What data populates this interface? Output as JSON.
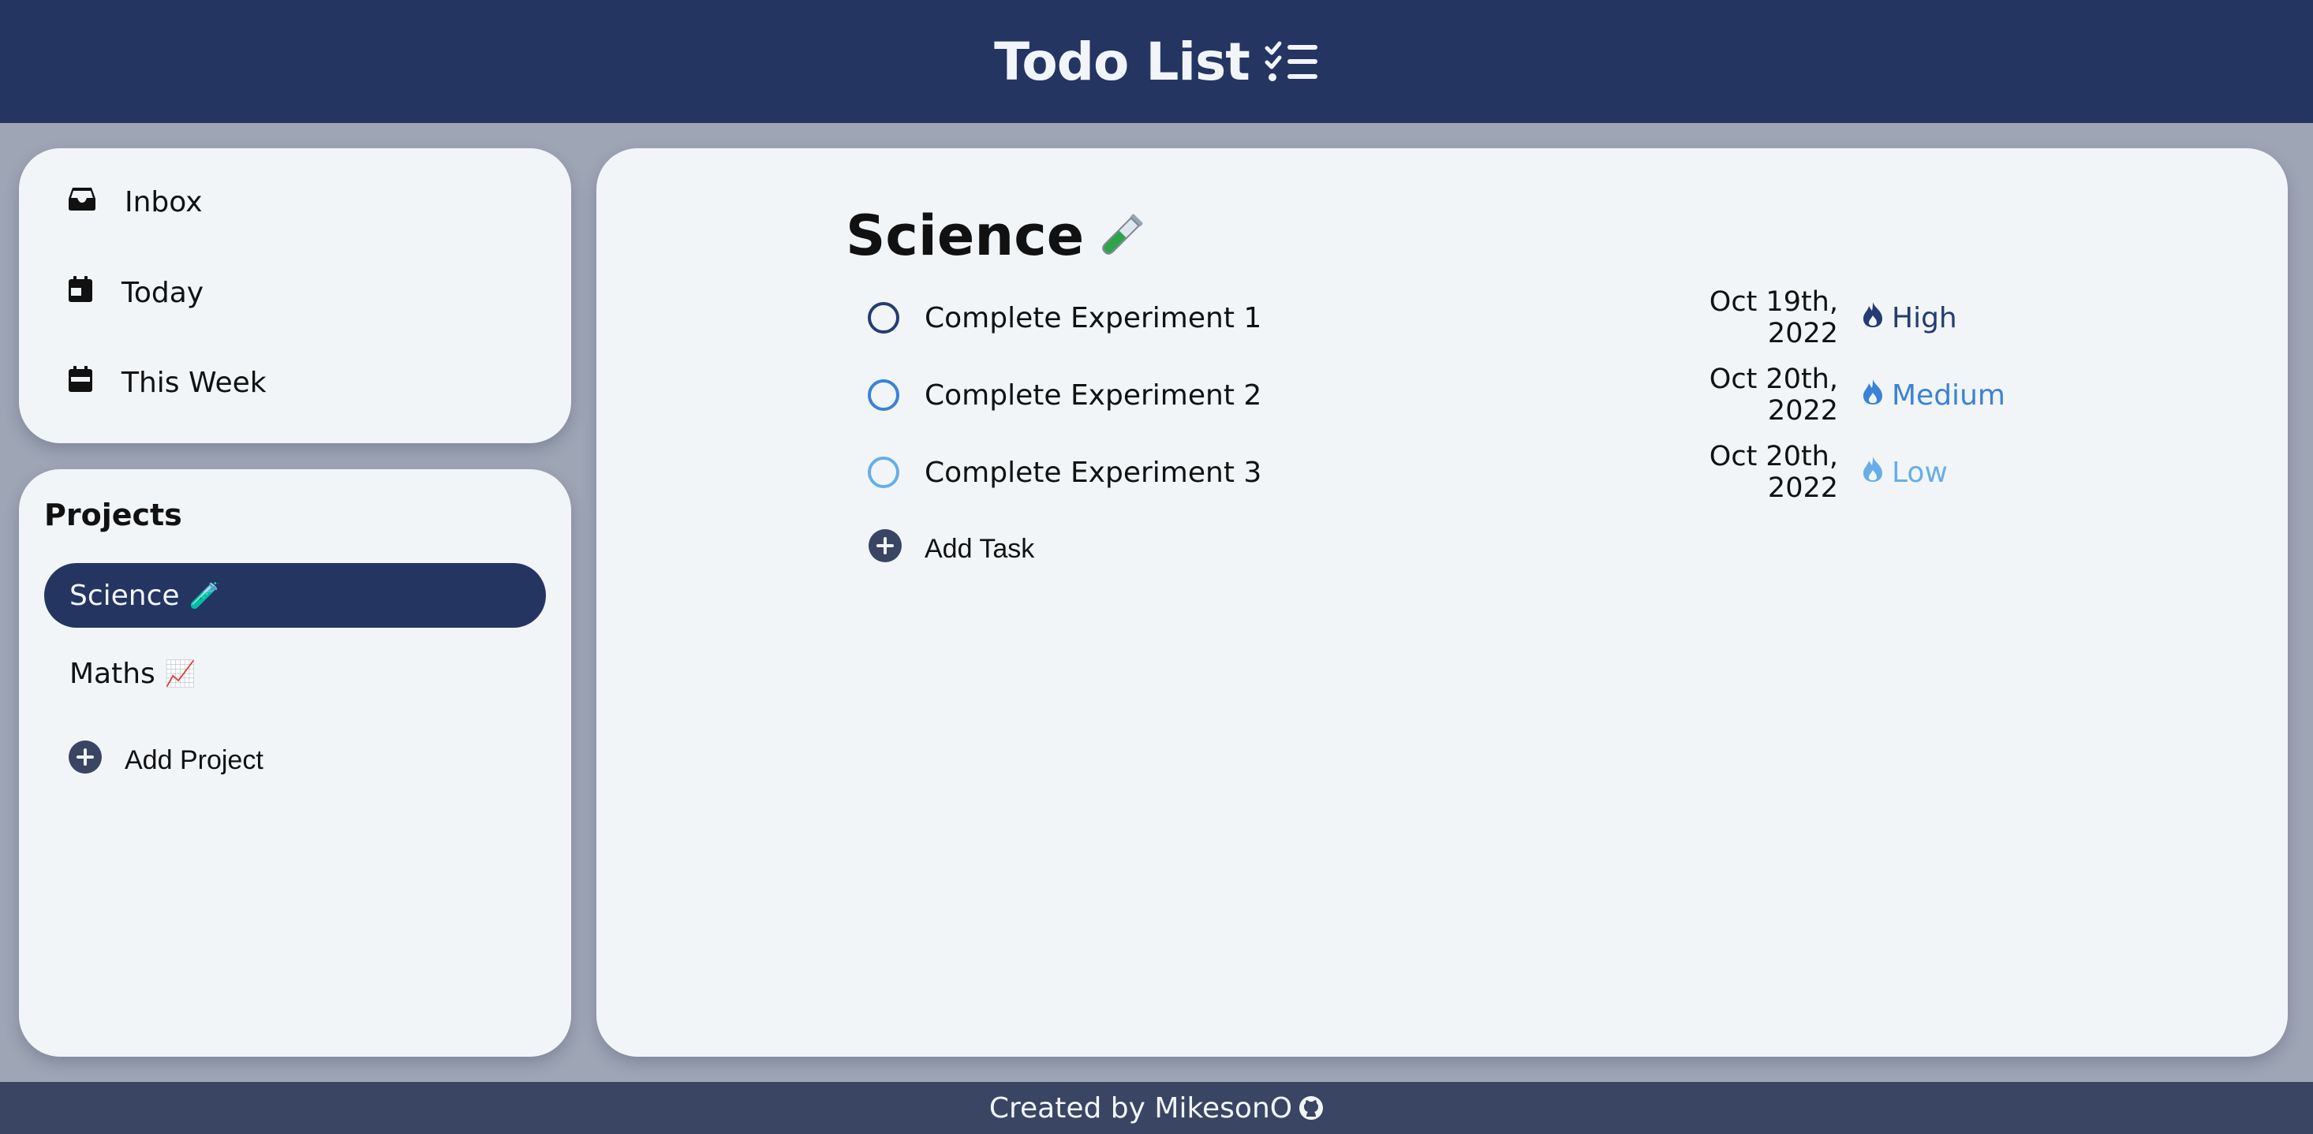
{
  "header": {
    "title": "Todo List",
    "icon": "checklist-icon"
  },
  "nav": {
    "items": [
      {
        "label": "Inbox",
        "icon": "inbox-icon"
      },
      {
        "label": "Today",
        "icon": "calendar-day-icon"
      },
      {
        "label": "This Week",
        "icon": "calendar-week-icon"
      }
    ]
  },
  "projects": {
    "heading": "Projects",
    "items": [
      {
        "label": "Science",
        "emoji": "🧪",
        "active": true
      },
      {
        "label": "Maths",
        "emoji": "📈",
        "active": false
      }
    ],
    "add_label": "Add Project"
  },
  "main": {
    "title": "Science",
    "title_emoji": "test-tube-icon",
    "tasks": [
      {
        "name": "Complete Experiment 1",
        "due": "Oct 19th, 2022",
        "priority": "High",
        "color": "#243c72",
        "circle": "#243c72"
      },
      {
        "name": "Complete Experiment 2",
        "due": "Oct 20th, 2022",
        "priority": "Medium",
        "color": "#3b82d6",
        "circle": "#3b82d6"
      },
      {
        "name": "Complete Experiment 3",
        "due": "Oct 20th, 2022",
        "priority": "Low",
        "color": "#67aee8",
        "circle": "#67aee8"
      }
    ],
    "add_label": "Add Task"
  },
  "footer": {
    "text": "Created by MikesonO",
    "icon": "github-icon"
  },
  "colors": {
    "primary": "#243562",
    "background": "#9ea5b5",
    "card": "#f1f5f8",
    "footer": "#3a4563"
  }
}
